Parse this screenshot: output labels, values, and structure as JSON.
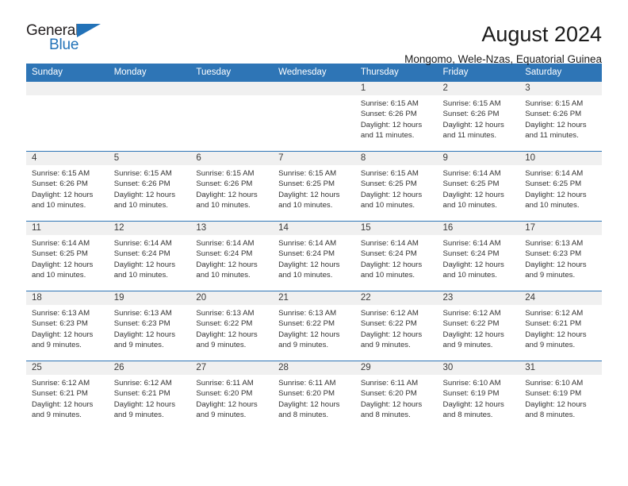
{
  "logo": {
    "word_top": "General",
    "word_bottom": "Blue",
    "triangle_color": "#2272b8",
    "icon": "general-blue-logo"
  },
  "header": {
    "title": "August 2024",
    "subtitle": "Mongomo, Wele-Nzas, Equatorial Guinea"
  },
  "colors": {
    "header_blue": "#2e75b6",
    "daynum_gray": "#f0f0f0",
    "logo_blue": "#2272b8"
  },
  "weekdays": [
    "Sunday",
    "Monday",
    "Tuesday",
    "Wednesday",
    "Thursday",
    "Friday",
    "Saturday"
  ],
  "weeks": [
    [
      {
        "day": "",
        "empty": true
      },
      {
        "day": "",
        "empty": true
      },
      {
        "day": "",
        "empty": true
      },
      {
        "day": "",
        "empty": true
      },
      {
        "day": "1",
        "sunrise": "Sunrise: 6:15 AM",
        "sunset": "Sunset: 6:26 PM",
        "daylight": "Daylight: 12 hours and 11 minutes."
      },
      {
        "day": "2",
        "sunrise": "Sunrise: 6:15 AM",
        "sunset": "Sunset: 6:26 PM",
        "daylight": "Daylight: 12 hours and 11 minutes."
      },
      {
        "day": "3",
        "sunrise": "Sunrise: 6:15 AM",
        "sunset": "Sunset: 6:26 PM",
        "daylight": "Daylight: 12 hours and 11 minutes."
      }
    ],
    [
      {
        "day": "4",
        "sunrise": "Sunrise: 6:15 AM",
        "sunset": "Sunset: 6:26 PM",
        "daylight": "Daylight: 12 hours and 10 minutes."
      },
      {
        "day": "5",
        "sunrise": "Sunrise: 6:15 AM",
        "sunset": "Sunset: 6:26 PM",
        "daylight": "Daylight: 12 hours and 10 minutes."
      },
      {
        "day": "6",
        "sunrise": "Sunrise: 6:15 AM",
        "sunset": "Sunset: 6:26 PM",
        "daylight": "Daylight: 12 hours and 10 minutes."
      },
      {
        "day": "7",
        "sunrise": "Sunrise: 6:15 AM",
        "sunset": "Sunset: 6:25 PM",
        "daylight": "Daylight: 12 hours and 10 minutes."
      },
      {
        "day": "8",
        "sunrise": "Sunrise: 6:15 AM",
        "sunset": "Sunset: 6:25 PM",
        "daylight": "Daylight: 12 hours and 10 minutes."
      },
      {
        "day": "9",
        "sunrise": "Sunrise: 6:14 AM",
        "sunset": "Sunset: 6:25 PM",
        "daylight": "Daylight: 12 hours and 10 minutes."
      },
      {
        "day": "10",
        "sunrise": "Sunrise: 6:14 AM",
        "sunset": "Sunset: 6:25 PM",
        "daylight": "Daylight: 12 hours and 10 minutes."
      }
    ],
    [
      {
        "day": "11",
        "sunrise": "Sunrise: 6:14 AM",
        "sunset": "Sunset: 6:25 PM",
        "daylight": "Daylight: 12 hours and 10 minutes."
      },
      {
        "day": "12",
        "sunrise": "Sunrise: 6:14 AM",
        "sunset": "Sunset: 6:24 PM",
        "daylight": "Daylight: 12 hours and 10 minutes."
      },
      {
        "day": "13",
        "sunrise": "Sunrise: 6:14 AM",
        "sunset": "Sunset: 6:24 PM",
        "daylight": "Daylight: 12 hours and 10 minutes."
      },
      {
        "day": "14",
        "sunrise": "Sunrise: 6:14 AM",
        "sunset": "Sunset: 6:24 PM",
        "daylight": "Daylight: 12 hours and 10 minutes."
      },
      {
        "day": "15",
        "sunrise": "Sunrise: 6:14 AM",
        "sunset": "Sunset: 6:24 PM",
        "daylight": "Daylight: 12 hours and 10 minutes."
      },
      {
        "day": "16",
        "sunrise": "Sunrise: 6:14 AM",
        "sunset": "Sunset: 6:24 PM",
        "daylight": "Daylight: 12 hours and 10 minutes."
      },
      {
        "day": "17",
        "sunrise": "Sunrise: 6:13 AM",
        "sunset": "Sunset: 6:23 PM",
        "daylight": "Daylight: 12 hours and 9 minutes."
      }
    ],
    [
      {
        "day": "18",
        "sunrise": "Sunrise: 6:13 AM",
        "sunset": "Sunset: 6:23 PM",
        "daylight": "Daylight: 12 hours and 9 minutes."
      },
      {
        "day": "19",
        "sunrise": "Sunrise: 6:13 AM",
        "sunset": "Sunset: 6:23 PM",
        "daylight": "Daylight: 12 hours and 9 minutes."
      },
      {
        "day": "20",
        "sunrise": "Sunrise: 6:13 AM",
        "sunset": "Sunset: 6:22 PM",
        "daylight": "Daylight: 12 hours and 9 minutes."
      },
      {
        "day": "21",
        "sunrise": "Sunrise: 6:13 AM",
        "sunset": "Sunset: 6:22 PM",
        "daylight": "Daylight: 12 hours and 9 minutes."
      },
      {
        "day": "22",
        "sunrise": "Sunrise: 6:12 AM",
        "sunset": "Sunset: 6:22 PM",
        "daylight": "Daylight: 12 hours and 9 minutes."
      },
      {
        "day": "23",
        "sunrise": "Sunrise: 6:12 AM",
        "sunset": "Sunset: 6:22 PM",
        "daylight": "Daylight: 12 hours and 9 minutes."
      },
      {
        "day": "24",
        "sunrise": "Sunrise: 6:12 AM",
        "sunset": "Sunset: 6:21 PM",
        "daylight": "Daylight: 12 hours and 9 minutes."
      }
    ],
    [
      {
        "day": "25",
        "sunrise": "Sunrise: 6:12 AM",
        "sunset": "Sunset: 6:21 PM",
        "daylight": "Daylight: 12 hours and 9 minutes."
      },
      {
        "day": "26",
        "sunrise": "Sunrise: 6:12 AM",
        "sunset": "Sunset: 6:21 PM",
        "daylight": "Daylight: 12 hours and 9 minutes."
      },
      {
        "day": "27",
        "sunrise": "Sunrise: 6:11 AM",
        "sunset": "Sunset: 6:20 PM",
        "daylight": "Daylight: 12 hours and 9 minutes."
      },
      {
        "day": "28",
        "sunrise": "Sunrise: 6:11 AM",
        "sunset": "Sunset: 6:20 PM",
        "daylight": "Daylight: 12 hours and 8 minutes."
      },
      {
        "day": "29",
        "sunrise": "Sunrise: 6:11 AM",
        "sunset": "Sunset: 6:20 PM",
        "daylight": "Daylight: 12 hours and 8 minutes."
      },
      {
        "day": "30",
        "sunrise": "Sunrise: 6:10 AM",
        "sunset": "Sunset: 6:19 PM",
        "daylight": "Daylight: 12 hours and 8 minutes."
      },
      {
        "day": "31",
        "sunrise": "Sunrise: 6:10 AM",
        "sunset": "Sunset: 6:19 PM",
        "daylight": "Daylight: 12 hours and 8 minutes."
      }
    ]
  ]
}
